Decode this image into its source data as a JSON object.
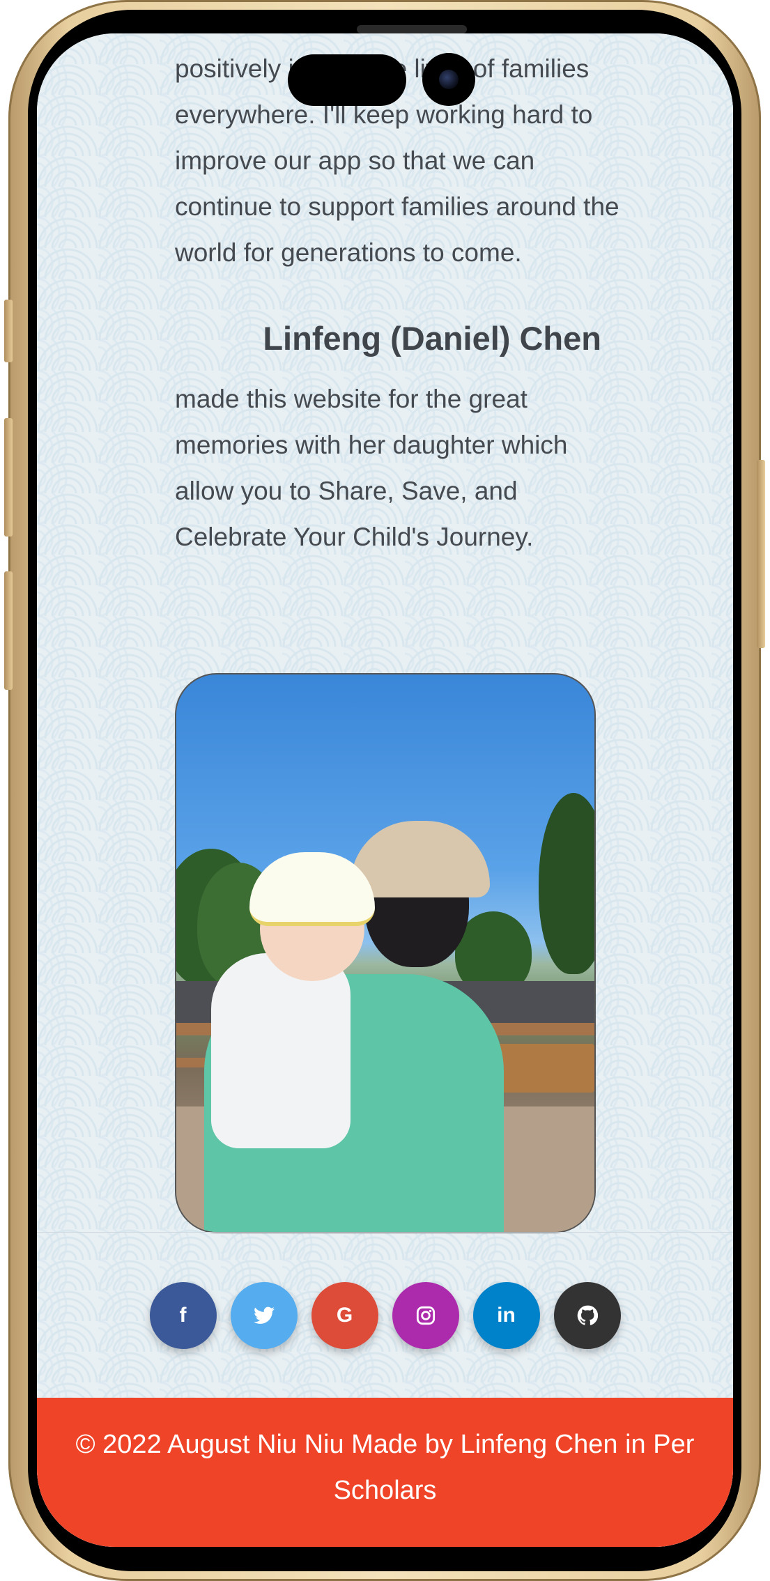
{
  "story": {
    "paragraph_lines": "positively impact the lives of families everywhere. I'll keep working hard to improve our app so that we can continue to support families around the world for generations to come."
  },
  "author": {
    "name": "Linfeng (Daniel) Chen",
    "bio": "made this website for the great memories with her daughter which allow you to Share, Save, and Celebrate Your Child's Journey."
  },
  "social": [
    {
      "name": "facebook",
      "glyph": "f",
      "color": "#3b5998"
    },
    {
      "name": "twitter",
      "glyph": "🐦",
      "color": "#55acee"
    },
    {
      "name": "google",
      "glyph": "G",
      "color": "#dd4b39"
    },
    {
      "name": "instagram",
      "glyph": "◎",
      "color": "#ac2bac"
    },
    {
      "name": "linkedin",
      "glyph": "in",
      "color": "#0082ca"
    },
    {
      "name": "github",
      "glyph": "●",
      "color": "#333333"
    }
  ],
  "footer": {
    "text": "© 2022 August Niu Niu Made by Linfeng Chen in Per Scholars"
  }
}
